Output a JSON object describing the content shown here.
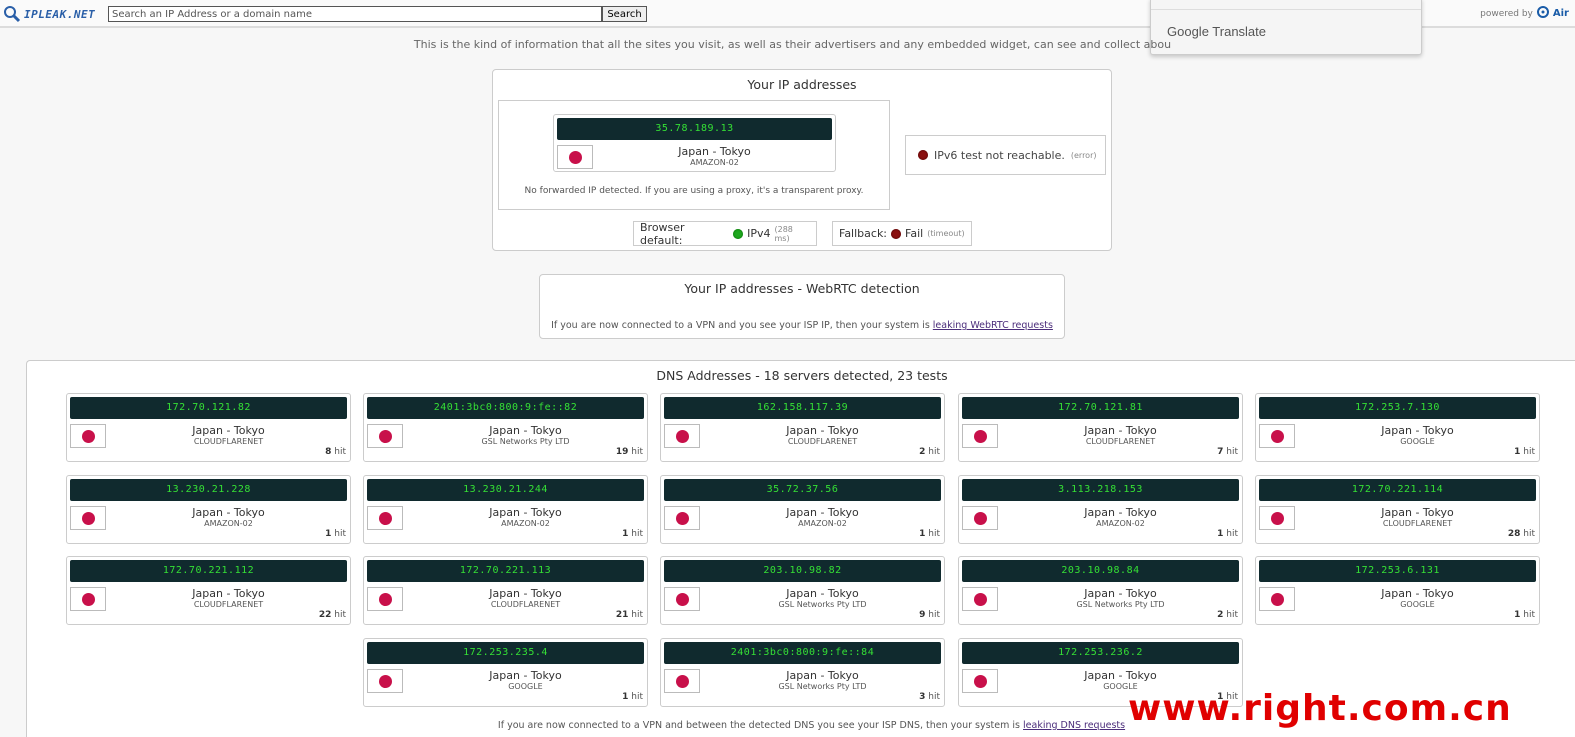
{
  "header": {
    "logo_text": "IPLEAK.NET",
    "search_placeholder": "Search an IP Address or a domain name",
    "search_button": "Search",
    "powered_by": "powered by",
    "powered_brand": "Air"
  },
  "translate_popup": {
    "label": "Google Translate"
  },
  "intro_text": "This is the kind of information that all the sites you visit, as well as their advertisers and any embedded widget, can see and collect abou",
  "ip_section": {
    "title": "Your IP addresses",
    "ip": "35.78.189.13",
    "location": "Japan - Tokyo",
    "isp": "AMAZON-02",
    "no_forward": "No forwarded IP detected. If you are using a proxy, it's a transparent proxy.",
    "ipv6_text": "IPv6 test not reachable.",
    "ipv6_note": "(error)",
    "browser_default_label": "Browser default:",
    "browser_default_value": "IPv4",
    "browser_default_time": "(288 ms)",
    "fallback_label": "Fallback:",
    "fallback_value": "Fail",
    "fallback_note": "(timeout)",
    "colors": {
      "ok": "#1fa81f",
      "fail": "#8b1010"
    }
  },
  "webrtc": {
    "title": "Your IP addresses - WebRTC detection",
    "note_prefix": "If you are now connected to a VPN and you see your ISP IP, then your system is ",
    "note_link": "leaking WebRTC requests"
  },
  "dns": {
    "title": "DNS Addresses - 18 servers detected, 23 tests",
    "servers": [
      {
        "ip": "172.70.121.82",
        "location": "Japan - Tokyo",
        "isp": "CLOUDFLARENET",
        "hits": "8",
        "hit_label": "hit"
      },
      {
        "ip": "2401:3bc0:800:9:fe::82",
        "location": "Japan - Tokyo",
        "isp": "GSL Networks Pty LTD",
        "hits": "19",
        "hit_label": "hit"
      },
      {
        "ip": "162.158.117.39",
        "location": "Japan - Tokyo",
        "isp": "CLOUDFLARENET",
        "hits": "2",
        "hit_label": "hit"
      },
      {
        "ip": "172.70.121.81",
        "location": "Japan - Tokyo",
        "isp": "CLOUDFLARENET",
        "hits": "7",
        "hit_label": "hit"
      },
      {
        "ip": "172.253.7.130",
        "location": "Japan - Tokyo",
        "isp": "GOOGLE",
        "hits": "1",
        "hit_label": "hit"
      },
      {
        "ip": "13.230.21.228",
        "location": "Japan - Tokyo",
        "isp": "AMAZON-02",
        "hits": "1",
        "hit_label": "hit"
      },
      {
        "ip": "13.230.21.244",
        "location": "Japan - Tokyo",
        "isp": "AMAZON-02",
        "hits": "1",
        "hit_label": "hit"
      },
      {
        "ip": "35.72.37.56",
        "location": "Japan - Tokyo",
        "isp": "AMAZON-02",
        "hits": "1",
        "hit_label": "hit"
      },
      {
        "ip": "3.113.218.153",
        "location": "Japan - Tokyo",
        "isp": "AMAZON-02",
        "hits": "1",
        "hit_label": "hit"
      },
      {
        "ip": "172.70.221.114",
        "location": "Japan - Tokyo",
        "isp": "CLOUDFLARENET",
        "hits": "28",
        "hit_label": "hit"
      },
      {
        "ip": "172.70.221.112",
        "location": "Japan - Tokyo",
        "isp": "CLOUDFLARENET",
        "hits": "22",
        "hit_label": "hit"
      },
      {
        "ip": "172.70.221.113",
        "location": "Japan - Tokyo",
        "isp": "CLOUDFLARENET",
        "hits": "21",
        "hit_label": "hit"
      },
      {
        "ip": "203.10.98.82",
        "location": "Japan - Tokyo",
        "isp": "GSL Networks Pty LTD",
        "hits": "9",
        "hit_label": "hit"
      },
      {
        "ip": "203.10.98.84",
        "location": "Japan - Tokyo",
        "isp": "GSL Networks Pty LTD",
        "hits": "2",
        "hit_label": "hit"
      },
      {
        "ip": "172.253.6.131",
        "location": "Japan - Tokyo",
        "isp": "GOOGLE",
        "hits": "1",
        "hit_label": "hit"
      },
      {
        "ip": "172.253.235.4",
        "location": "Japan - Tokyo",
        "isp": "GOOGLE",
        "hits": "1",
        "hit_label": "hit"
      },
      {
        "ip": "2401:3bc0:800:9:fe::84",
        "location": "Japan - Tokyo",
        "isp": "GSL Networks Pty LTD",
        "hits": "3",
        "hit_label": "hit"
      },
      {
        "ip": "172.253.236.2",
        "location": "Japan - Tokyo",
        "isp": "GOOGLE",
        "hits": "1",
        "hit_label": "hit"
      }
    ],
    "note_prefix": "If you are now connected to a VPN and between the detected DNS you see your ISP DNS, then your system is ",
    "note_link": "leaking DNS requests"
  },
  "watermark": "www.right.com.cn"
}
